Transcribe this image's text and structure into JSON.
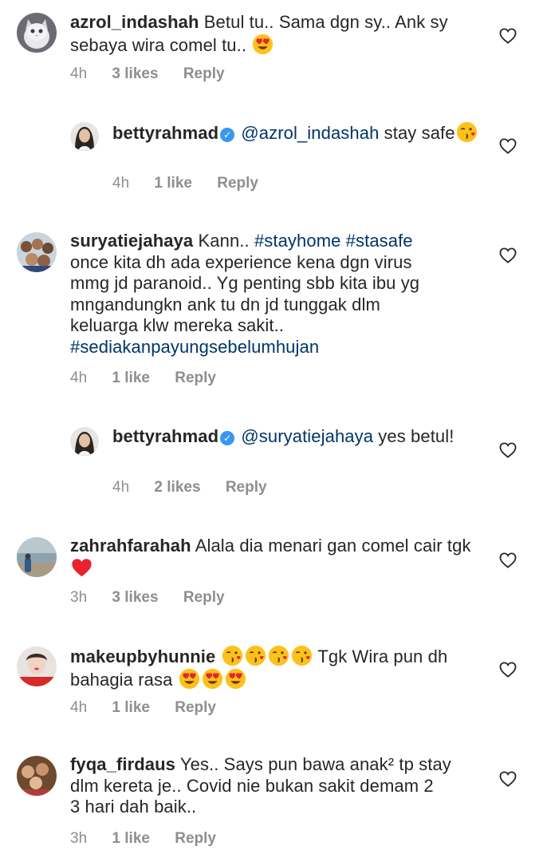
{
  "comments": [
    {
      "username": "azrol_indashah",
      "text": "Betul tu.. Sama dgn sy.. Ank sy sebaya wira comel tu..",
      "time": "4h",
      "likes": "3 likes",
      "reply": "Reply",
      "avatar_icon": "cat-avatar"
    },
    {
      "username": "bettyrahmad",
      "verified": true,
      "mention": "@azrol_indashah",
      "text": "stay safe",
      "time": "4h",
      "likes": "1 like",
      "reply": "Reply",
      "avatar_icon": "woman-avatar"
    },
    {
      "username": "suryatiejahaya",
      "text_before": "Kann..",
      "hashtag1": "#stayhome",
      "hashtag2": "#stasafe",
      "line2": "once kita dh ada experience kena dgn virus",
      "line3": "mmg jd paranoid.. Yg penting sbb kita ibu yg",
      "line4": "mngandungkn ank tu dn jd tunggak dlm",
      "line5": "keluarga klw mereka sakit..",
      "hashtag3": "#sediakanpayungsebelumhujan",
      "time": "4h",
      "likes": "1 like",
      "reply": "Reply",
      "avatar_icon": "group-avatar"
    },
    {
      "username": "bettyrahmad",
      "verified": true,
      "mention": "@suryatiejahaya",
      "text": "yes betul!",
      "time": "4h",
      "likes": "2 likes",
      "reply": "Reply",
      "avatar_icon": "woman-avatar"
    },
    {
      "username": "zahrahfarahah",
      "text": "Alala dia menari gan comel cair tgk",
      "time": "3h",
      "likes": "3 likes",
      "reply": "Reply",
      "avatar_icon": "beach-avatar"
    },
    {
      "username": "makeupbyhunnie",
      "text": "Tgk Wira pun dh bahagia rasa",
      "time": "4h",
      "likes": "1 like",
      "reply": "Reply",
      "avatar_icon": "face-avatar"
    },
    {
      "username": "fyqa_firdaus",
      "text": "Yes.. Says pun bawa anak² tp stay dlm kereta je.. Covid nie bukan sakit demam 2 3 hari dah baik..",
      "line1": "Yes.. Says pun bawa anak² tp stay",
      "line2": "dlm kereta je.. Covid nie bukan sakit demam 2",
      "line3": "3 hari dah baik..",
      "time": "3h",
      "likes": "1 like",
      "reply": "Reply",
      "avatar_icon": "family-avatar"
    }
  ],
  "colors": {
    "text": "#262626",
    "meta": "#8e8e8e",
    "link": "#003569",
    "verified": "#3897f0",
    "heart_red": "#e8232e"
  }
}
